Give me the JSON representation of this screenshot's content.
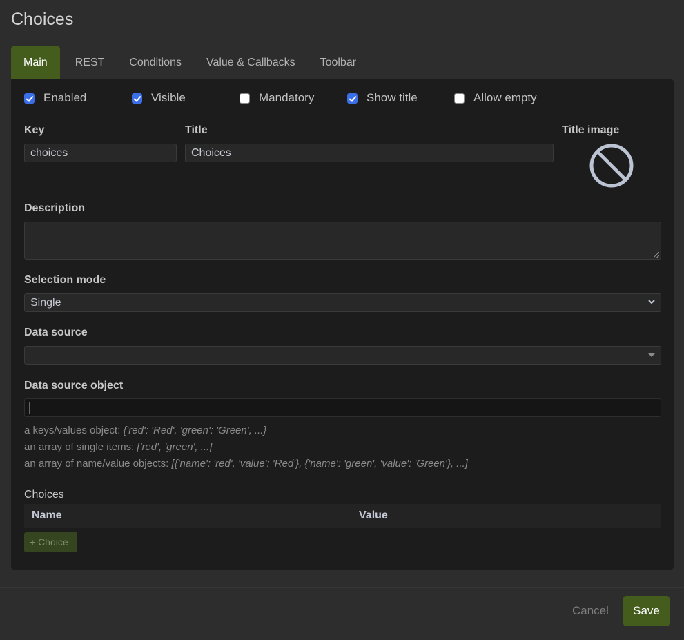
{
  "dialog": {
    "title": "Choices"
  },
  "tabs": [
    {
      "label": "Main",
      "active": true
    },
    {
      "label": "REST",
      "active": false
    },
    {
      "label": "Conditions",
      "active": false
    },
    {
      "label": "Value & Callbacks",
      "active": false
    },
    {
      "label": "Toolbar",
      "active": false
    }
  ],
  "checkboxes": [
    {
      "label": "Enabled",
      "checked": true
    },
    {
      "label": "Visible",
      "checked": true
    },
    {
      "label": "Mandatory",
      "checked": false
    },
    {
      "label": "Show title",
      "checked": true
    },
    {
      "label": "Allow empty",
      "checked": false
    }
  ],
  "fields": {
    "key": {
      "label": "Key",
      "value": "choices"
    },
    "title": {
      "label": "Title",
      "value": "Choices"
    },
    "title_image": {
      "label": "Title image",
      "icon": "no-image-icon"
    },
    "description": {
      "label": "Description",
      "value": ""
    },
    "selection_mode": {
      "label": "Selection mode",
      "value": "Single"
    },
    "data_source": {
      "label": "Data source",
      "value": ""
    },
    "data_source_object": {
      "label": "Data source object",
      "value": ""
    }
  },
  "help": [
    {
      "prefix": "a keys/values object: ",
      "example": "{'red': 'Red', 'green': 'Green', ...}"
    },
    {
      "prefix": "an array of single items: ",
      "example": "['red', 'green', ...]"
    },
    {
      "prefix": "an array of name/value objects: ",
      "example": "[{'name': 'red', 'value': 'Red'}, {'name': 'green', 'value': 'Green'}, ...]"
    }
  ],
  "choices": {
    "title": "Choices",
    "columns": [
      "Name",
      "Value"
    ],
    "rows": [],
    "add_label": "+ Choice"
  },
  "footer": {
    "cancel_label": "Cancel",
    "save_label": "Save"
  },
  "colors": {
    "accent": "#445d1d",
    "checkbox": "#3b6fe8",
    "panel": "#1c1c1c",
    "background": "#2d2d2d"
  }
}
